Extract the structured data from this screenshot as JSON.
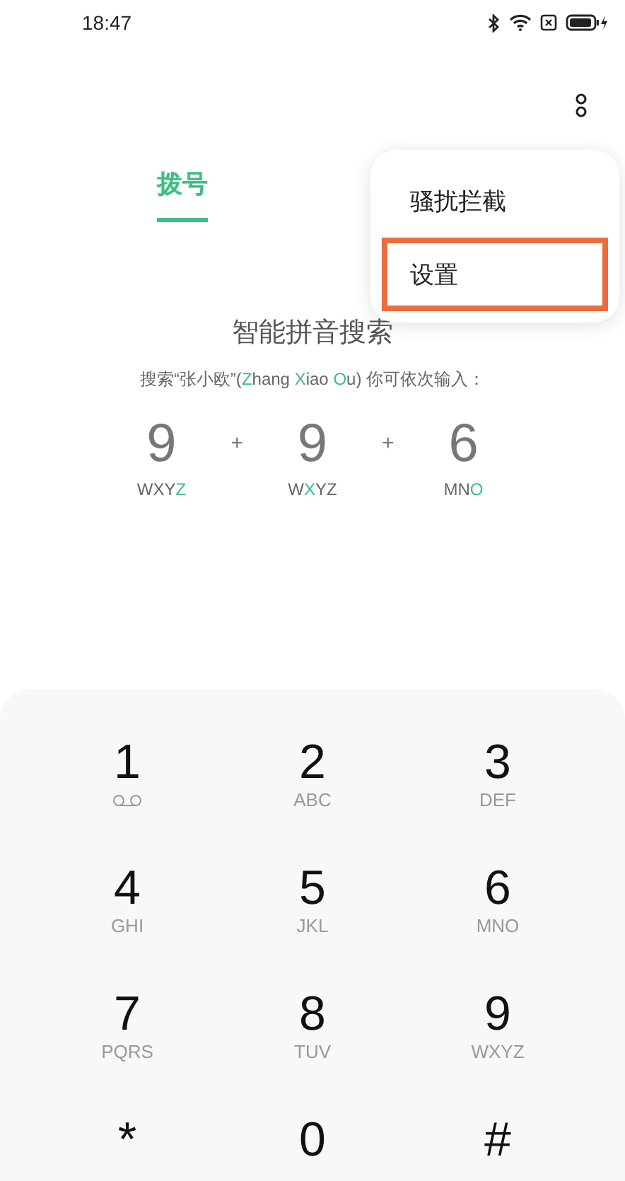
{
  "status_bar": {
    "time": "18:47"
  },
  "tabs": [
    {
      "label": "拨号",
      "selected": true
    }
  ],
  "menu": {
    "items": [
      {
        "label": "骚扰拦截",
        "highlighted": false
      },
      {
        "label": "设置",
        "highlighted": true
      }
    ]
  },
  "hint": {
    "title": "智能拼音搜索",
    "sentence": [
      {
        "text": "搜索“张小欧”(",
        "accent": false
      },
      {
        "text": "Z",
        "accent": true
      },
      {
        "text": "hang ",
        "accent": false
      },
      {
        "text": "X",
        "accent": true
      },
      {
        "text": "iao ",
        "accent": false
      },
      {
        "text": "O",
        "accent": true
      },
      {
        "text": "u) 你可依次输入：",
        "accent": false
      }
    ],
    "keys": [
      {
        "digit": "9",
        "letters": [
          {
            "text": "WXY",
            "accent": false
          },
          {
            "text": "Z",
            "accent": true
          }
        ]
      },
      {
        "digit": "9",
        "letters": [
          {
            "text": "W",
            "accent": false
          },
          {
            "text": "X",
            "accent": true
          },
          {
            "text": "YZ",
            "accent": false
          }
        ]
      },
      {
        "digit": "6",
        "letters": [
          {
            "text": "MN",
            "accent": false
          },
          {
            "text": "O",
            "accent": true
          }
        ]
      }
    ],
    "plus": "+"
  },
  "keypad": [
    {
      "digit": "1",
      "kind": "voicemail"
    },
    {
      "digit": "2",
      "letters": "ABC",
      "kind": "letters"
    },
    {
      "digit": "3",
      "letters": "DEF",
      "kind": "letters"
    },
    {
      "digit": "4",
      "letters": "GHI",
      "kind": "letters"
    },
    {
      "digit": "5",
      "letters": "JKL",
      "kind": "letters"
    },
    {
      "digit": "6",
      "letters": "MNO",
      "kind": "letters"
    },
    {
      "digit": "7",
      "letters": "PQRS",
      "kind": "letters"
    },
    {
      "digit": "8",
      "letters": "TUV",
      "kind": "letters"
    },
    {
      "digit": "9",
      "letters": "WXYZ",
      "kind": "letters"
    },
    {
      "digit": "*",
      "kind": "plain"
    },
    {
      "digit": "0",
      "kind": "plain"
    },
    {
      "digit": "#",
      "kind": "plain"
    }
  ]
}
